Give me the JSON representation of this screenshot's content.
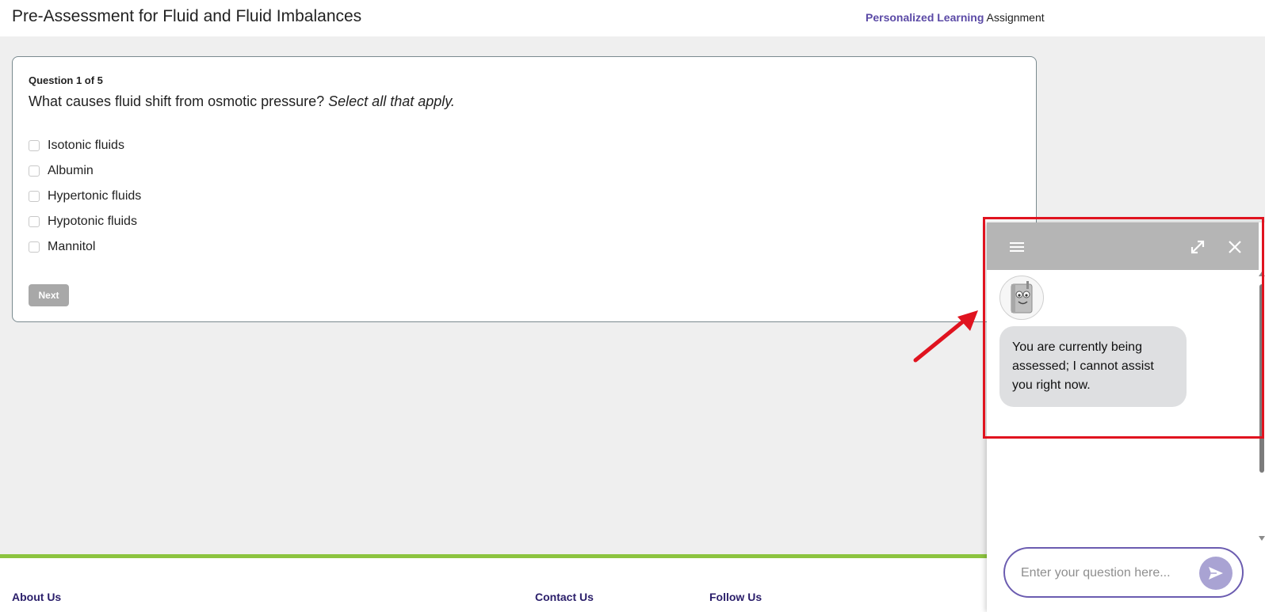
{
  "header": {
    "title": "Pre-Assessment for Fluid and Fluid Imbalances",
    "assignment_type_highlight": "Personalized Learning",
    "assignment_type_rest": "Assignment"
  },
  "question": {
    "counter": "Question 1 of 5",
    "text": "What causes fluid shift from osmotic pressure?",
    "instruction": "Select all that apply.",
    "options": [
      {
        "label": "Isotonic fluids",
        "checked": false
      },
      {
        "label": "Albumin",
        "checked": false
      },
      {
        "label": "Hypertonic fluids",
        "checked": false
      },
      {
        "label": "Hypotonic fluids",
        "checked": false
      },
      {
        "label": "Mannitol",
        "checked": false
      }
    ],
    "next_label": "Next"
  },
  "footer": {
    "about": "About Us",
    "contact": "Contact Us",
    "follow": "Follow Us"
  },
  "chat": {
    "header_icons": [
      "menu-icon",
      "expand-icon",
      "close-icon"
    ],
    "message": "You are currently being assessed; I cannot assist you right now.",
    "input_placeholder": "Enter your question here...",
    "send_icon": "send-icon"
  },
  "colors": {
    "brand_purple": "#5b4aa6",
    "footer_accent": "#8cc43f",
    "annotation_red": "#e0131f",
    "chat_header": "#b5b5b5"
  }
}
